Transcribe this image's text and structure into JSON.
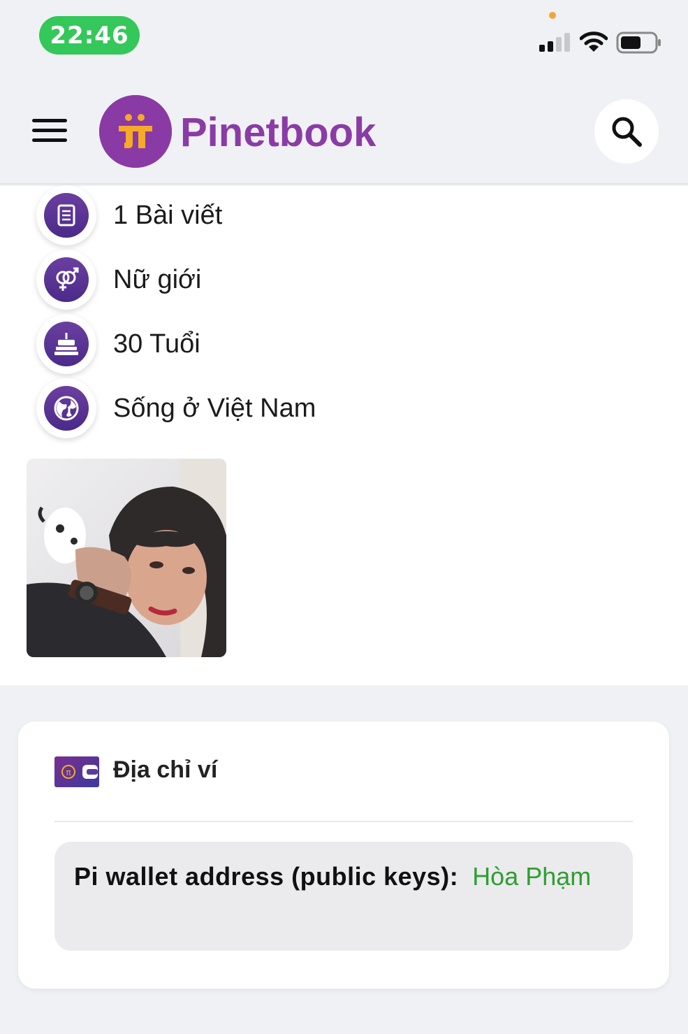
{
  "status_bar": {
    "time": "22:46",
    "colors": {
      "time_pill": "#34c759",
      "privacy_dot": "#f5a33a"
    }
  },
  "header": {
    "brand_name": "Pinetbook",
    "logo_glyph": "π",
    "menu_icon": "hamburger-icon",
    "search_icon": "search-icon",
    "colors": {
      "brand": "#8b3ba6"
    }
  },
  "profile_info": {
    "items": [
      {
        "icon": "document-icon",
        "text": "1 Bài viết"
      },
      {
        "icon": "gender-icon",
        "text": "Nữ giới"
      },
      {
        "icon": "birthday-cake-icon",
        "text": "30 Tuổi"
      },
      {
        "icon": "globe-icon",
        "text": "Sống ở Việt Nam"
      }
    ]
  },
  "wallet": {
    "title": "Địa chỉ ví",
    "label": "Pi wallet address (public keys):",
    "value": "Hòa Phạm",
    "colors": {
      "value": "#2f9e2f"
    }
  }
}
